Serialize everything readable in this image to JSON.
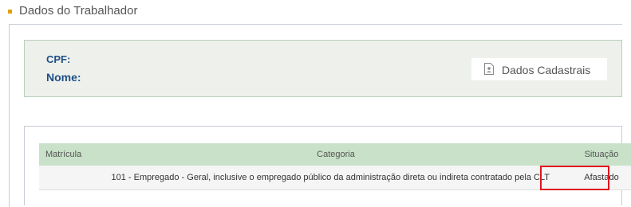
{
  "section": {
    "title": "Dados do Trabalhador"
  },
  "info": {
    "cpf_label": "CPF:",
    "nome_label": "Nome:",
    "dados_button_label": "Dados Cadastrais",
    "dados_icon": "document-user-icon"
  },
  "table": {
    "headers": {
      "matricula": "Matrícula",
      "categoria": "Categoria",
      "situacao": "Situação"
    },
    "rows": [
      {
        "matricula": "",
        "categoria": "101 - Empregado - Geral, inclusive o empregado público da administração direta ou indireta contratado pela CLT",
        "situacao": "Afastado"
      }
    ]
  },
  "colors": {
    "accent_bullet": "#e0a000",
    "label_blue": "#1e4f86",
    "header_green": "#c8e1c8",
    "highlight_red": "#e0141e"
  }
}
